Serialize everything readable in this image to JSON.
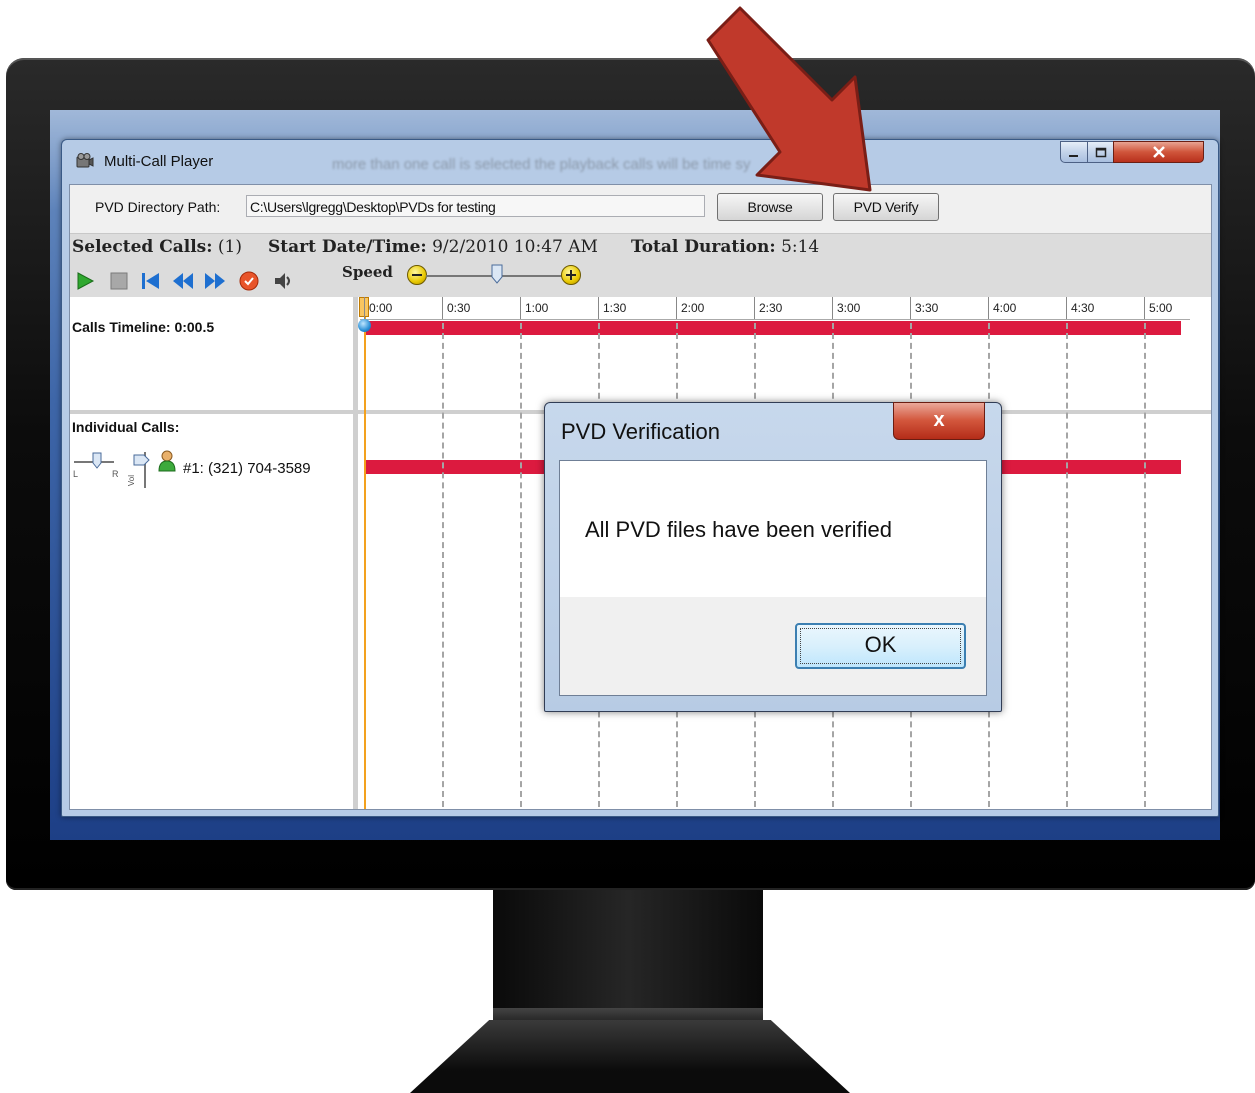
{
  "window": {
    "title": "Multi-Call Player",
    "watermark": "more than one call is selected the playback calls will be time sy"
  },
  "path_row": {
    "label": "PVD Directory Path:",
    "value": "C:\\Users\\lgregg\\Desktop\\PVDs for testing",
    "browse_label": "Browse",
    "verify_label": "PVD Verify"
  },
  "info": {
    "selected_label": "Selected Calls:",
    "selected_value": "(1)",
    "start_label": "Start Date/Time:",
    "start_value": "9/2/2010 10:47 AM",
    "duration_label": "Total Duration:",
    "duration_value": "5:14",
    "speed_label": "Speed",
    "speed_level": 0.5
  },
  "timeline": {
    "calls_timeline_label": "Calls Timeline: 0:00.5",
    "individual_calls_label": "Individual Calls:",
    "ticks": [
      "0:00",
      "0:30",
      "1:00",
      "1:30",
      "2:00",
      "2:30",
      "3:00",
      "3:30",
      "4:00",
      "4:30",
      "5:00"
    ],
    "calls": [
      {
        "label": "#1: (321) 704-3589"
      }
    ],
    "pan_left": "L",
    "pan_right": "R",
    "vol_label": "Vol"
  },
  "dialog": {
    "title": "PVD Verification",
    "close_glyph": "x",
    "message": "All PVD files have been verified",
    "ok_label": "OK"
  },
  "colors": {
    "timeline_bar": "#dc1a3f",
    "playhead": "#f3a11e",
    "arrow": "#c0392b"
  }
}
